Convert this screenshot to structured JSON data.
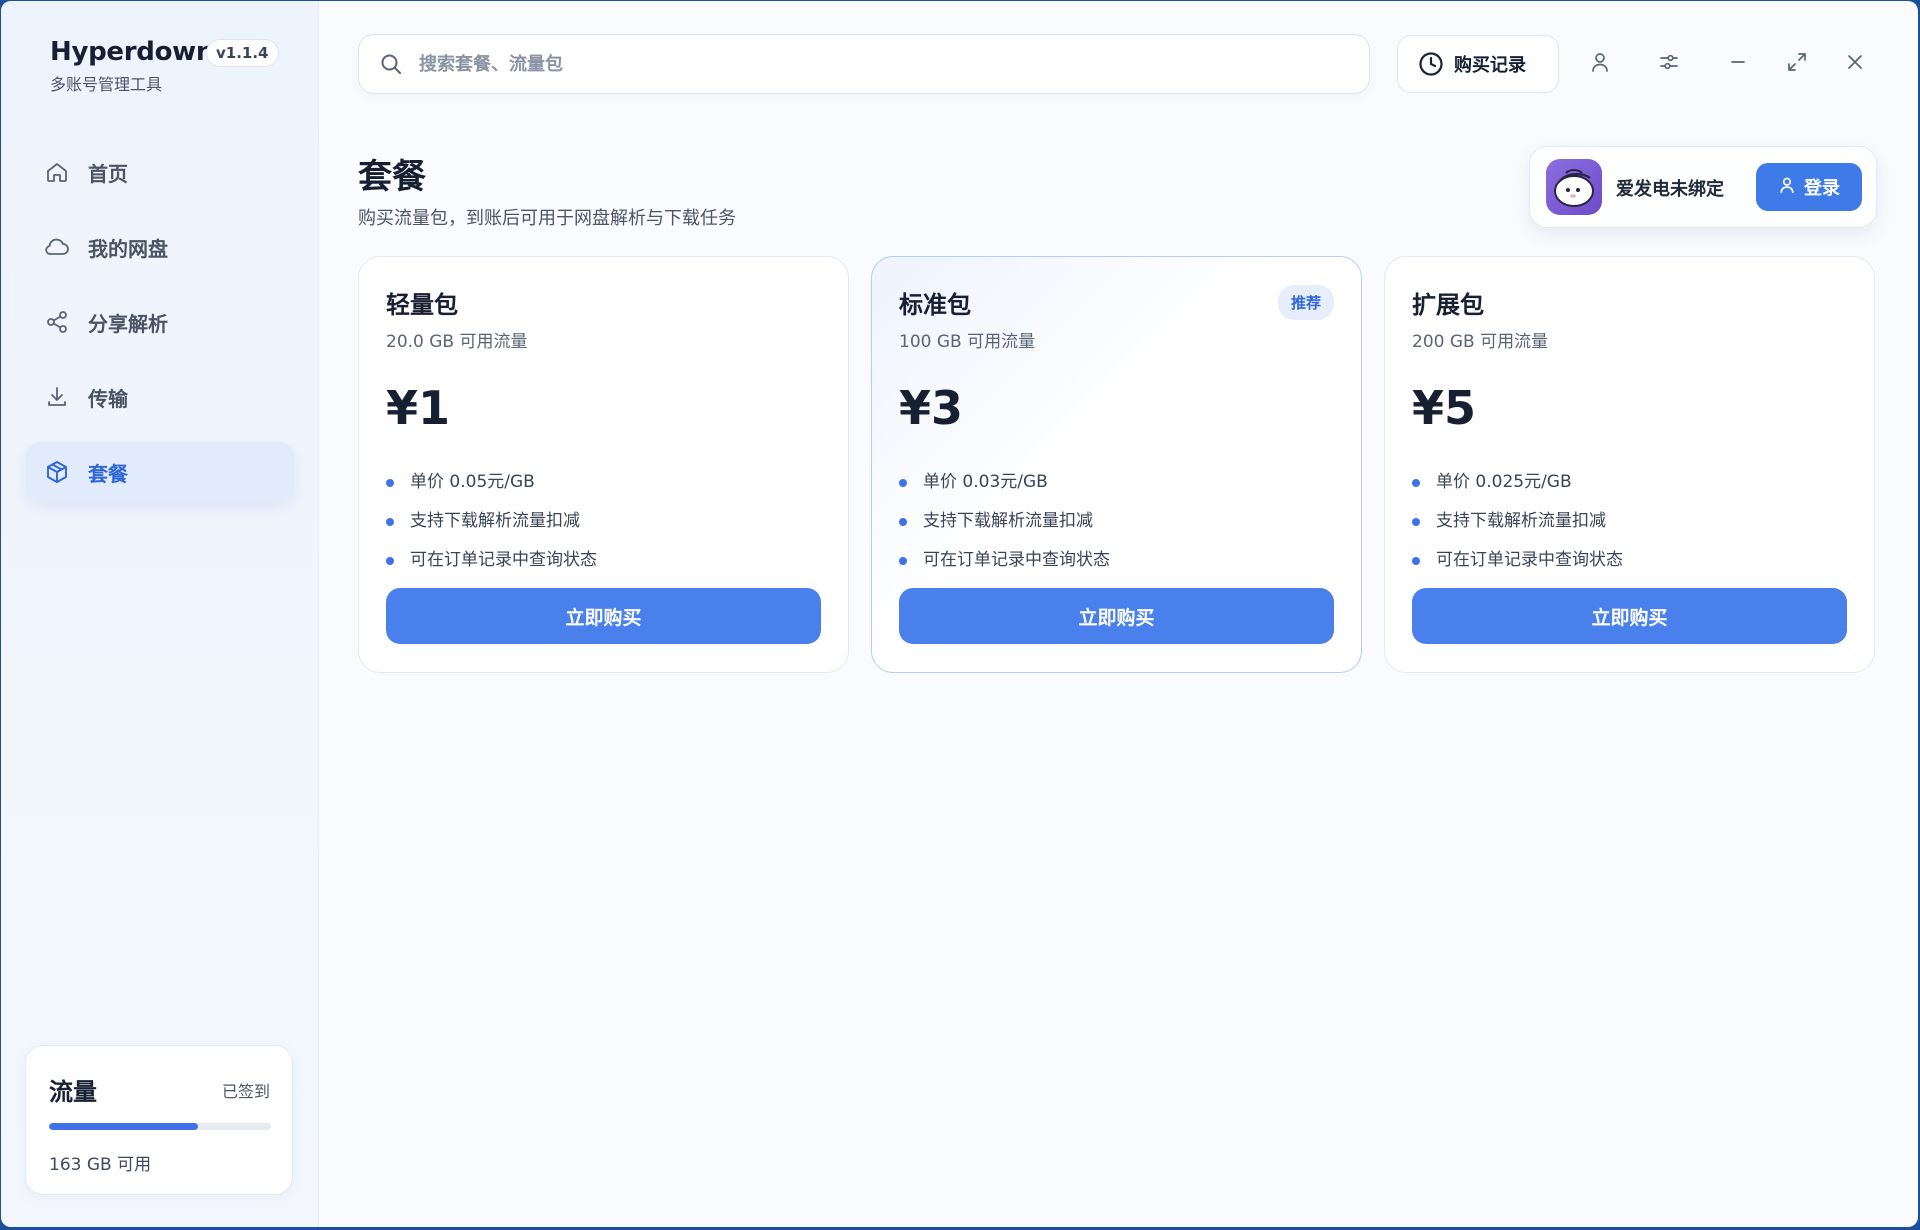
{
  "app": {
    "name": "Hyperdown",
    "version": "v1.1.4",
    "subtitle": "多账号管理工具"
  },
  "sidebar": {
    "items": [
      {
        "label": "首页",
        "icon": "home-icon",
        "active": false
      },
      {
        "label": "我的网盘",
        "icon": "cloud-icon",
        "active": false
      },
      {
        "label": "分享解析",
        "icon": "share-icon",
        "active": false
      },
      {
        "label": "传输",
        "icon": "download-icon",
        "active": false
      },
      {
        "label": "套餐",
        "icon": "package-icon",
        "active": true
      }
    ],
    "traffic": {
      "title": "流量",
      "status": "已签到",
      "amount": "163 GB 可用",
      "progress": 0.67
    }
  },
  "topbar": {
    "search_placeholder": "搜索套餐、流量包",
    "history_label": "购买记录"
  },
  "page": {
    "title": "套餐",
    "subtitle": "购买流量包，到账后可用于网盘解析与下载任务"
  },
  "account": {
    "name": "爱发电未绑定",
    "login_label": "登录"
  },
  "plans": [
    {
      "name": "轻量包",
      "sub": "20.0 GB 可用流量",
      "price": "¥1",
      "badge": "",
      "features": [
        "单价 0.05元/GB",
        "支持下载解析流量扣减",
        "可在订单记录中查询状态"
      ],
      "button": "立即购买"
    },
    {
      "name": "标准包",
      "sub": "100 GB 可用流量",
      "price": "¥3",
      "badge": "推荐",
      "features": [
        "单价 0.03元/GB",
        "支持下载解析流量扣减",
        "可在订单记录中查询状态"
      ],
      "button": "立即购买"
    },
    {
      "name": "扩展包",
      "sub": "200 GB 可用流量",
      "price": "¥5",
      "badge": "",
      "features": [
        "单价 0.025元/GB",
        "支持下载解析流量扣减",
        "可在订单记录中查询状态"
      ],
      "button": "立即购买"
    }
  ],
  "colors": {
    "accent": "#3f7be8",
    "active_nav_bg": "#e2ebfb",
    "active_nav_text": "#2f66d8"
  }
}
